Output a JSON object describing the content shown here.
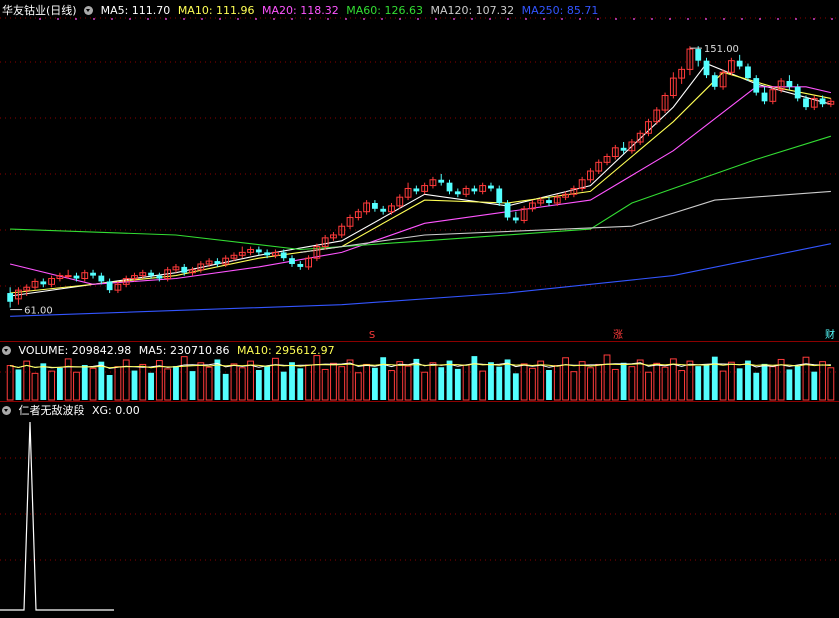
{
  "colors": {
    "up": "#ff3b3b",
    "down": "#54ffff",
    "ma5": "#ffffff",
    "ma10": "#ffff55",
    "ma20": "#ff55ff",
    "ma60": "#33dd33",
    "ma120": "#cccccc",
    "ma250": "#3355ff",
    "grid": "#8b0000"
  },
  "main_header": {
    "stock": "华友钴业(日线)",
    "ma5": "MA5: 111.70",
    "ma10": "MA10: 111.96",
    "ma20": "MA20: 118.32",
    "ma60": "MA60: 126.63",
    "ma120": "MA120: 107.32",
    "ma250": "MA250: 85.71"
  },
  "price_annotations": {
    "high": "151.00",
    "low": "61.00"
  },
  "event_markers": [
    "S",
    "涨",
    "财"
  ],
  "volume_header": {
    "label": "VOLUME: 209842.98",
    "ma5": "MA5: 230710.86",
    "ma10": "MA10: 295612.97"
  },
  "indicator_header": {
    "label": "仁者无敌波段",
    "xg": "XG: 0.00"
  },
  "chart_data": [
    {
      "type": "candlestick",
      "title": "华友钴业(日线)",
      "ylim": [
        55,
        160
      ],
      "annotations": [
        {
          "text": "151.00",
          "at": "high"
        },
        {
          "text": "61.00",
          "at": "low"
        }
      ],
      "candles": [
        [
          66,
          63,
          68,
          61
        ],
        [
          64,
          67,
          68,
          62
        ],
        [
          67,
          68,
          69,
          65
        ],
        [
          68,
          70,
          71,
          67
        ],
        [
          70,
          69,
          71,
          68
        ],
        [
          69,
          71,
          72,
          68
        ],
        [
          71,
          72,
          73,
          70
        ],
        [
          72,
          72,
          74,
          71
        ],
        [
          72,
          71,
          73,
          70
        ],
        [
          71,
          73,
          74,
          70
        ],
        [
          73,
          72,
          74,
          71
        ],
        [
          72,
          70,
          73,
          69
        ],
        [
          70,
          67,
          71,
          66
        ],
        [
          67,
          69,
          70,
          66
        ],
        [
          69,
          71,
          72,
          68
        ],
        [
          71,
          72,
          73,
          70
        ],
        [
          72,
          73,
          74,
          71
        ],
        [
          73,
          72,
          74,
          71
        ],
        [
          72,
          71,
          73,
          70
        ],
        [
          71,
          74,
          75,
          70
        ],
        [
          74,
          75,
          76,
          73
        ],
        [
          75,
          73,
          76,
          72
        ],
        [
          73,
          74,
          75,
          72
        ],
        [
          74,
          76,
          77,
          73
        ],
        [
          76,
          77,
          78,
          75
        ],
        [
          77,
          76,
          78,
          75
        ],
        [
          76,
          78,
          79,
          75
        ],
        [
          78,
          79,
          80,
          77
        ],
        [
          79,
          80,
          82,
          78
        ],
        [
          80,
          81,
          82,
          79
        ],
        [
          81,
          80,
          82,
          79
        ],
        [
          80,
          79,
          81,
          78
        ],
        [
          79,
          80,
          81,
          78
        ],
        [
          80,
          78,
          81,
          77
        ],
        [
          78,
          76,
          79,
          75
        ],
        [
          76,
          75,
          77,
          74
        ],
        [
          75,
          78,
          79,
          74
        ],
        [
          78,
          82,
          83,
          77
        ],
        [
          82,
          85,
          86,
          81
        ],
        [
          85,
          86,
          87,
          84
        ],
        [
          86,
          89,
          90,
          85
        ],
        [
          89,
          92,
          93,
          88
        ],
        [
          92,
          94,
          95,
          91
        ],
        [
          94,
          97,
          98,
          93
        ],
        [
          97,
          95,
          98,
          94
        ],
        [
          95,
          94,
          96,
          93
        ],
        [
          94,
          96,
          97,
          93
        ],
        [
          96,
          99,
          100,
          95
        ],
        [
          99,
          102,
          104,
          98
        ],
        [
          102,
          101,
          103,
          100
        ],
        [
          101,
          103,
          104,
          100
        ],
        [
          103,
          105,
          106,
          102
        ],
        [
          105,
          104,
          107,
          103
        ],
        [
          104,
          101,
          105,
          100
        ],
        [
          101,
          100,
          102,
          99
        ],
        [
          100,
          102,
          103,
          99
        ],
        [
          102,
          101,
          103,
          100
        ],
        [
          101,
          103,
          104,
          100
        ],
        [
          103,
          102,
          104,
          101
        ],
        [
          102,
          97,
          103,
          96
        ],
        [
          97,
          92,
          98,
          91
        ],
        [
          92,
          91,
          94,
          90
        ],
        [
          91,
          95,
          96,
          90
        ],
        [
          95,
          97,
          98,
          94
        ],
        [
          97,
          98,
          99,
          96
        ],
        [
          98,
          97,
          99,
          96
        ],
        [
          97,
          99,
          100,
          96
        ],
        [
          99,
          100,
          101,
          98
        ],
        [
          100,
          102,
          103,
          99
        ],
        [
          102,
          105,
          106,
          101
        ],
        [
          105,
          108,
          109,
          104
        ],
        [
          108,
          111,
          112,
          107
        ],
        [
          111,
          113,
          114,
          110
        ],
        [
          113,
          116,
          117,
          112
        ],
        [
          116,
          115,
          118,
          114
        ],
        [
          115,
          118,
          119,
          114
        ],
        [
          118,
          121,
          122,
          117
        ],
        [
          121,
          125,
          126,
          120
        ],
        [
          125,
          129,
          130,
          124
        ],
        [
          129,
          134,
          135,
          128
        ],
        [
          134,
          140,
          142,
          133
        ],
        [
          140,
          143,
          144,
          138
        ],
        [
          143,
          150,
          151,
          141
        ],
        [
          150,
          146,
          151,
          144
        ],
        [
          146,
          141,
          147,
          140
        ],
        [
          141,
          137,
          142,
          136
        ],
        [
          137,
          142,
          143,
          136
        ],
        [
          142,
          146,
          147,
          141
        ],
        [
          146,
          144,
          148,
          143
        ],
        [
          144,
          140,
          145,
          139
        ],
        [
          140,
          135,
          141,
          134
        ],
        [
          135,
          132,
          137,
          131
        ],
        [
          132,
          136,
          137,
          131
        ],
        [
          136,
          139,
          140,
          135
        ],
        [
          139,
          137,
          141,
          136
        ],
        [
          137,
          133,
          138,
          132
        ],
        [
          133,
          130,
          134,
          129
        ],
        [
          130,
          133,
          134,
          129
        ],
        [
          133,
          131,
          134,
          130
        ],
        [
          131,
          132,
          133,
          130
        ]
      ],
      "ma_lines": [
        {
          "name": "MA5",
          "values_at": [
            [
              0,
              65
            ],
            [
              20,
              73
            ],
            [
              30,
              79
            ],
            [
              40,
              84
            ],
            [
              50,
              100
            ],
            [
              60,
              96
            ],
            [
              70,
              103
            ],
            [
              80,
              130
            ],
            [
              84,
              145
            ],
            [
              90,
              138
            ],
            [
              99,
              131
            ]
          ]
        },
        {
          "name": "MA10",
          "values_at": [
            [
              0,
              66
            ],
            [
              20,
              72
            ],
            [
              30,
              78
            ],
            [
              40,
              82
            ],
            [
              50,
              98
            ],
            [
              60,
              97
            ],
            [
              70,
              101
            ],
            [
              80,
              125
            ],
            [
              86,
              142
            ],
            [
              92,
              137
            ],
            [
              99,
              133
            ]
          ]
        },
        {
          "name": "MA20",
          "values_at": [
            [
              0,
              76
            ],
            [
              10,
              69
            ],
            [
              20,
              71
            ],
            [
              30,
              75
            ],
            [
              40,
              80
            ],
            [
              50,
              90
            ],
            [
              60,
              94
            ],
            [
              70,
              98
            ],
            [
              80,
              115
            ],
            [
              90,
              137
            ],
            [
              96,
              137
            ],
            [
              99,
              135
            ]
          ]
        },
        {
          "name": "MA60",
          "values_at": [
            [
              0,
              88
            ],
            [
              20,
              86
            ],
            [
              35,
              81
            ],
            [
              50,
              84
            ],
            [
              70,
              88
            ],
            [
              75,
              97
            ],
            [
              90,
              112
            ],
            [
              99,
              120
            ]
          ]
        },
        {
          "name": "MA120",
          "values_at": [
            [
              35,
              80
            ],
            [
              50,
              86
            ],
            [
              75,
              89
            ],
            [
              85,
              98
            ],
            [
              99,
              101
            ]
          ]
        },
        {
          "name": "MA250",
          "values_at": [
            [
              0,
              58
            ],
            [
              40,
              62
            ],
            [
              60,
              66
            ],
            [
              80,
              72
            ],
            [
              99,
              83
            ]
          ]
        }
      ]
    },
    {
      "type": "bar",
      "title": "VOLUME",
      "values": [
        62,
        55,
        70,
        48,
        66,
        52,
        58,
        74,
        50,
        63,
        57,
        69,
        45,
        60,
        72,
        53,
        64,
        49,
        71,
        56,
        61,
        78,
        52,
        67,
        59,
        73,
        47,
        65,
        58,
        70,
        54,
        62,
        75,
        51,
        68,
        57,
        63,
        80,
        55,
        66,
        60,
        72,
        49,
        64,
        58,
        77,
        53,
        69,
        61,
        74,
        50,
        67,
        59,
        71,
        56,
        63,
        79,
        52,
        68,
        60,
        73,
        48,
        65,
        57,
        70,
        54,
        62,
        76,
        51,
        69,
        58,
        64,
        81,
        55,
        67,
        60,
        72,
        50,
        66,
        59,
        74,
        53,
        70,
        61,
        63,
        78,
        52,
        68,
        57,
        71,
        49,
        65,
        60,
        73,
        55,
        62,
        77,
        51,
        69,
        58
      ],
      "up_flags": [
        1,
        0,
        1,
        1,
        0,
        1,
        0,
        1,
        1,
        0,
        1,
        0,
        0,
        1,
        1,
        0,
        1,
        0,
        1,
        1,
        0,
        1,
        0,
        1,
        1,
        0,
        0,
        1,
        1,
        1,
        0,
        0,
        1,
        0,
        0,
        0,
        1,
        1,
        1,
        1,
        1,
        1,
        1,
        1,
        0,
        0,
        1,
        1,
        1,
        0,
        1,
        1,
        0,
        0,
        0,
        1,
        0,
        1,
        0,
        0,
        0,
        0,
        1,
        1,
        1,
        0,
        1,
        1,
        1,
        1,
        1,
        1,
        1,
        1,
        0,
        1,
        1,
        1,
        1,
        1,
        1,
        1,
        1,
        0,
        0,
        0,
        1,
        1,
        0,
        0,
        0,
        0,
        1,
        1,
        0,
        0,
        1,
        0,
        1,
        1
      ]
    },
    {
      "type": "line",
      "title": "仁者无敌波段",
      "series": [
        {
          "name": "XG",
          "values": [
            0,
            0,
            0,
            0,
            0,
            1,
            0,
            0,
            0,
            0,
            0,
            0,
            0,
            0,
            0,
            0,
            0,
            0,
            0,
            0
          ]
        }
      ]
    }
  ]
}
